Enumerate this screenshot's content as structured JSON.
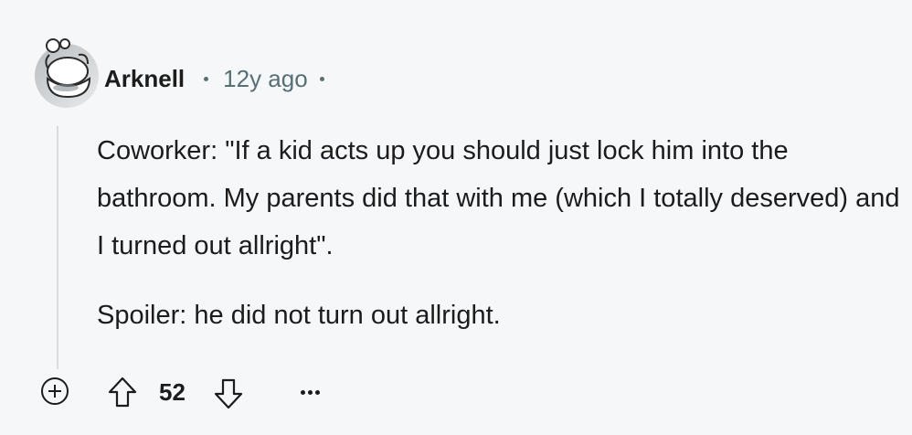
{
  "comment": {
    "author": "Arknell",
    "age": "12y ago",
    "body": [
      "Coworker: \"If a kid acts up you should just lock him into the bathroom. My parents did that with me (which I totally deserved) and I turned out allright\".",
      "Spoiler: he did not turn out allright."
    ],
    "score": "52"
  },
  "icons": {
    "avatar": "snoo-avatar-icon",
    "expand": "plus-circle-icon",
    "upvote": "arrow-up-icon",
    "downvote": "arrow-down-icon",
    "more": "ellipsis-icon"
  },
  "colors": {
    "background": "#f6f7f8",
    "text": "#1c1c1c",
    "meta": "#576f76",
    "thread_line": "#d8dcdf"
  }
}
